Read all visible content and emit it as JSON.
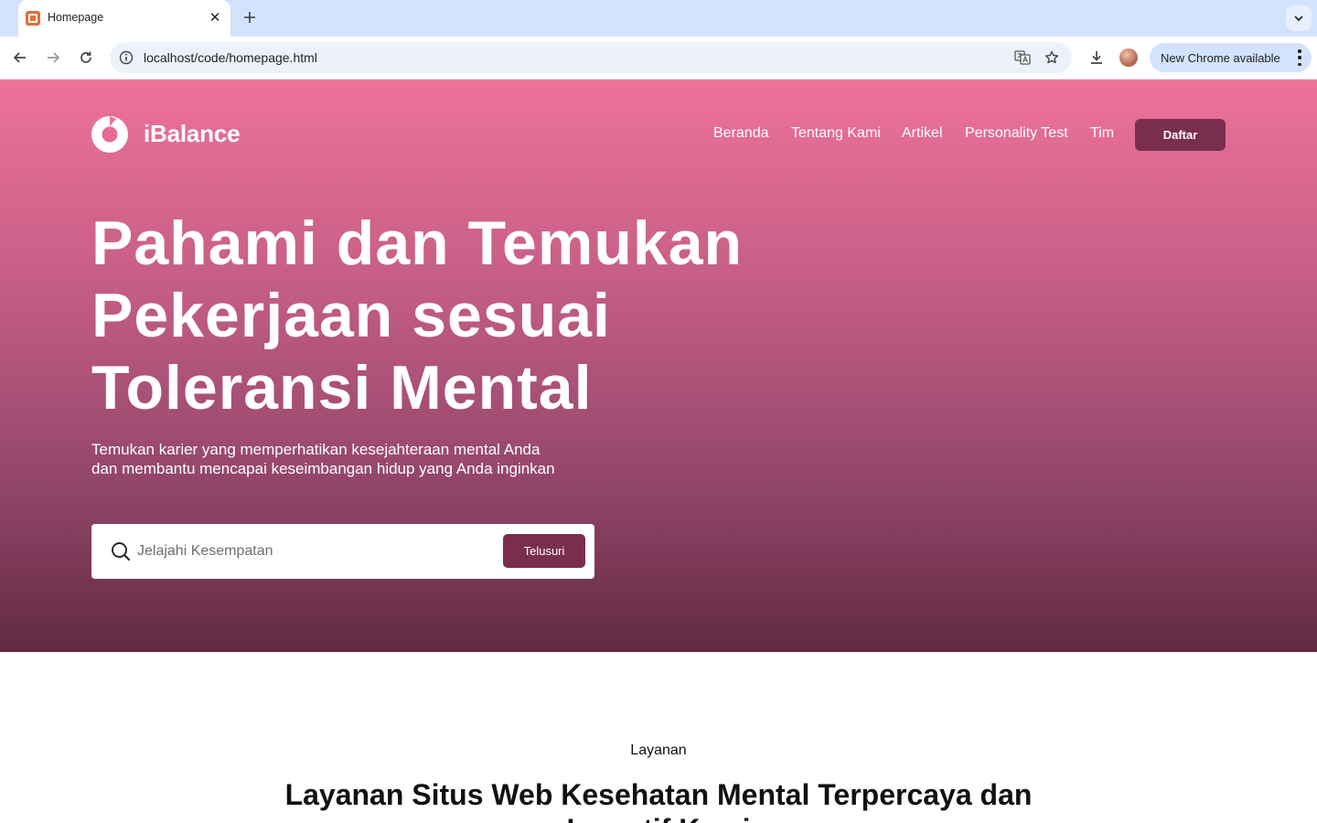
{
  "browser": {
    "tab_title": "Homepage",
    "url": "localhost/code/homepage.html",
    "update_label": "New Chrome available",
    "icons": {
      "favicon": "page-favicon",
      "close": "close-icon",
      "new_tab": "plus-icon",
      "tab_menu": "chevron-down-icon",
      "back": "back-arrow-icon",
      "forward": "forward-arrow-icon",
      "reload": "reload-icon",
      "site_info": "site-info-icon",
      "translate": "translate-icon",
      "bookmark": "star-icon",
      "download": "download-icon",
      "profile": "avatar",
      "menu": "kebab-menu-icon"
    }
  },
  "site": {
    "brand": "iBalance",
    "nav": [
      "Beranda",
      "Tentang Kami",
      "Artikel",
      "Personality Test",
      "Tim"
    ],
    "cta_label": "Daftar",
    "colors": {
      "hero_top": "#ee7299",
      "hero_bottom": "#622b42",
      "button": "#7a2e4d"
    }
  },
  "hero": {
    "title_lines": [
      "Pahami dan Temukan",
      "Pekerjaan sesuai",
      "Toleransi Mental"
    ],
    "subtitle_lines": [
      "Temukan karier yang memperhatikan kesejahteraan mental Anda",
      "dan membantu mencapai keseimbangan hidup yang Anda inginkan"
    ],
    "search": {
      "placeholder": "Jelajahi Kesempatan",
      "value": "",
      "button_label": "Telusuri"
    }
  },
  "services": {
    "eyebrow": "Layanan",
    "title": "Layanan Situs Web Kesehatan Mental Terpercaya dan Inovatif Kami"
  }
}
